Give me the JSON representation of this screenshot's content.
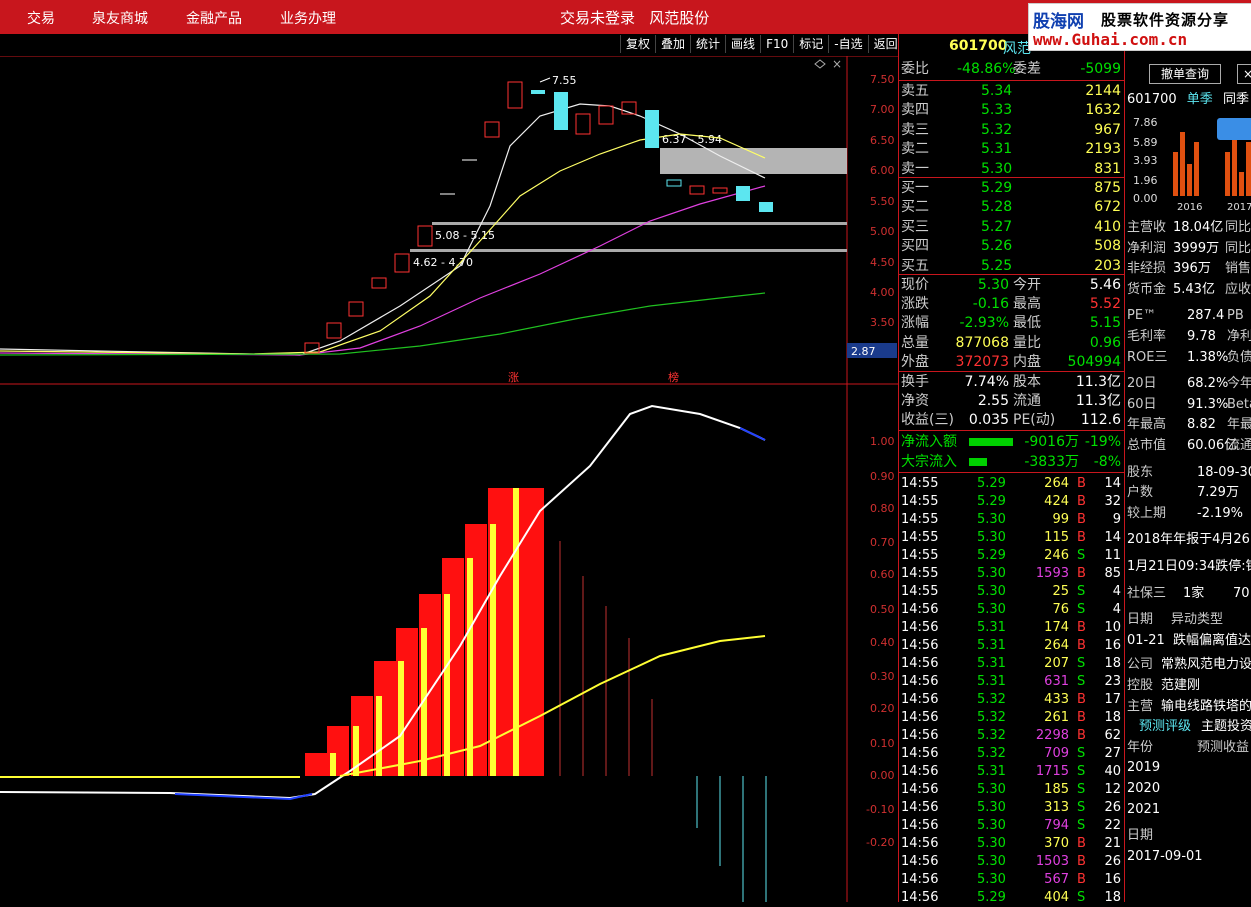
{
  "topbar": {
    "menu": [
      "交易",
      "泉友商城",
      "金融产品",
      "业务办理"
    ],
    "title": "交易未登录   风范股份",
    "ad_line1": "股海网",
    "ad_line1b": "股票软件资源分享",
    "ad_line2": "www.Guhai.com.cn"
  },
  "toolbar": [
    "复权",
    "叠加",
    "统计",
    "画线",
    "F10",
    "标记",
    "-自选",
    "返回"
  ],
  "price_axis": [
    "7.50",
    "7.00",
    "6.50",
    "6.00",
    "5.50",
    "5.00",
    "4.50",
    "4.00",
    "3.50"
  ],
  "price_tag": "2.87",
  "chart_annotations": [
    "7.55",
    "6.37 - 5.94",
    "5.08 - 5.15",
    "4.62 - 4.70",
    "涨",
    "榜"
  ],
  "ind_axis": [
    "1.00",
    "0.90",
    "0.80",
    "0.70",
    "0.60",
    "0.50",
    "0.40",
    "0.30",
    "0.20",
    "0.10",
    "0.00",
    "-0.10",
    "-0.20"
  ],
  "quote": {
    "code": "601700",
    "name": "风范",
    "weibi_label": "委比",
    "weibi": "-48.86%",
    "weicha_label": "委差",
    "weicha": "-5099",
    "asks": [
      {
        "label": "卖五",
        "price": "5.34",
        "vol": "2144"
      },
      {
        "label": "卖四",
        "price": "5.33",
        "vol": "1632"
      },
      {
        "label": "卖三",
        "price": "5.32",
        "vol": "967"
      },
      {
        "label": "卖二",
        "price": "5.31",
        "vol": "2193"
      },
      {
        "label": "卖一",
        "price": "5.30",
        "vol": "831"
      }
    ],
    "bids": [
      {
        "label": "买一",
        "price": "5.29",
        "vol": "875"
      },
      {
        "label": "买二",
        "price": "5.28",
        "vol": "672"
      },
      {
        "label": "买三",
        "price": "5.27",
        "vol": "410"
      },
      {
        "label": "买四",
        "price": "5.26",
        "vol": "508"
      },
      {
        "label": "买五",
        "price": "5.25",
        "vol": "203"
      }
    ],
    "stats": [
      {
        "l1": "现价",
        "v1": "5.30",
        "c1": "down",
        "l2": "今开",
        "v2": "5.46",
        "c2": "wht"
      },
      {
        "l1": "涨跌",
        "v1": "-0.16",
        "c1": "down",
        "l2": "最高",
        "v2": "5.52",
        "c2": "up"
      },
      {
        "l1": "涨幅",
        "v1": "-2.93%",
        "c1": "down",
        "l2": "最低",
        "v2": "5.15",
        "c2": "down"
      },
      {
        "l1": "总量",
        "v1": "877068",
        "c1": "yel",
        "l2": "量比",
        "v2": "0.96",
        "c2": "down"
      },
      {
        "l1": "外盘",
        "v1": "372073",
        "c1": "up",
        "l2": "内盘",
        "v2": "504994",
        "c2": "down"
      }
    ],
    "stats2": [
      {
        "l1": "换手",
        "v1": "7.74%",
        "l2": "股本",
        "v2": "11.3亿"
      },
      {
        "l1": "净资",
        "v1": "2.55",
        "l2": "流通",
        "v2": "11.3亿"
      },
      {
        "l1": "收益(三)",
        "v1": "0.035",
        "l2": "PE(动)",
        "v2": "112.6"
      }
    ],
    "flow": [
      {
        "label": "净流入额",
        "value": "-9016万",
        "pct": "-19%"
      },
      {
        "label": "大宗流入",
        "value": "-3833万",
        "pct": "-8%"
      }
    ],
    "ticks": [
      [
        "14:55",
        "5.29",
        "264",
        "B",
        "14"
      ],
      [
        "14:55",
        "5.29",
        "424",
        "B",
        "32"
      ],
      [
        "14:55",
        "5.30",
        "99",
        "B",
        "9"
      ],
      [
        "14:55",
        "5.30",
        "115",
        "B",
        "14"
      ],
      [
        "14:55",
        "5.29",
        "246",
        "S",
        "11"
      ],
      [
        "14:55",
        "5.30",
        "1593",
        "B",
        "85"
      ],
      [
        "14:55",
        "5.30",
        "25",
        "S",
        "4"
      ],
      [
        "14:56",
        "5.30",
        "76",
        "S",
        "4"
      ],
      [
        "14:56",
        "5.31",
        "174",
        "B",
        "10"
      ],
      [
        "14:56",
        "5.31",
        "264",
        "B",
        "16"
      ],
      [
        "14:56",
        "5.31",
        "207",
        "S",
        "18"
      ],
      [
        "14:56",
        "5.31",
        "631",
        "S",
        "23"
      ],
      [
        "14:56",
        "5.32",
        "433",
        "B",
        "17"
      ],
      [
        "14:56",
        "5.32",
        "261",
        "B",
        "18"
      ],
      [
        "14:56",
        "5.32",
        "2298",
        "B",
        "62"
      ],
      [
        "14:56",
        "5.32",
        "709",
        "S",
        "27"
      ],
      [
        "14:56",
        "5.31",
        "1715",
        "S",
        "40"
      ],
      [
        "14:56",
        "5.30",
        "185",
        "S",
        "12"
      ],
      [
        "14:56",
        "5.30",
        "313",
        "S",
        "26"
      ],
      [
        "14:56",
        "5.30",
        "794",
        "S",
        "22"
      ],
      [
        "14:56",
        "5.30",
        "370",
        "B",
        "21"
      ],
      [
        "14:56",
        "5.30",
        "1503",
        "B",
        "26"
      ],
      [
        "14:56",
        "5.30",
        "567",
        "B",
        "16"
      ],
      [
        "14:56",
        "5.29",
        "404",
        "S",
        "18"
      ]
    ]
  },
  "far": {
    "btn_cancel": "撤单查询",
    "code": "601700",
    "tab1": "单季",
    "tab2": "同季",
    "mini_axis": [
      "7.86",
      "5.89",
      "3.93",
      "1.96",
      "0.00"
    ],
    "mini_years": [
      "2016",
      "2017"
    ],
    "fin": [
      {
        "l": "主营收",
        "v": "18.04亿",
        "x": "同比"
      },
      {
        "l": "净利润",
        "v": "3999万",
        "x": "同比"
      },
      {
        "l": "非经损",
        "v": "396万",
        "x": "销售"
      },
      {
        "l": "货币金",
        "v": "5.43亿",
        "x": "应收"
      }
    ],
    "fin2": [
      {
        "l": "PE™",
        "v": "287.4",
        "x": "PB"
      },
      {
        "l": "毛利率",
        "v": "9.78",
        "x": "净利"
      },
      {
        "l": "ROE三",
        "v": "1.38%",
        "x": "负债"
      }
    ],
    "fin3": [
      {
        "l": "20日",
        "v": "68.2%",
        "x": "今年"
      },
      {
        "l": "60日",
        "v": "91.3%",
        "x": "Beta"
      },
      {
        "l": "年最高",
        "v": "8.82",
        "x": "年最"
      },
      {
        "l": "总市值",
        "v": "60.06亿",
        "x": "流通"
      }
    ],
    "holders": [
      {
        "l": "股东",
        "v": "18-09-30"
      },
      {
        "l": "户数",
        "v": "7.29万"
      },
      {
        "l": "较上期",
        "v": "-2.19%"
      }
    ],
    "notice1": "2018年年报于4月26",
    "notice2": "1月21日09:34跌停:银",
    "social_label": "社保三",
    "social_count": "1家",
    "social_val": "70",
    "event_head_l": "日期",
    "event_head_r": "异动类型",
    "event_date": "01-21",
    "event_text": "跌幅偏离值达",
    "company_label": "公司",
    "company": "常熟风范电力设",
    "ctrl_label": "控股",
    "ctrl": "范建刚",
    "main_label": "主营",
    "main": "输电线路铁塔的",
    "tab_rating": "预测评级",
    "tab_theme": "主题投资",
    "forecast_head_l": "年份",
    "forecast_head_r": "预测收益",
    "years": [
      "2019",
      "2020",
      "2021"
    ],
    "date_label": "日期",
    "date_val": "2017-09-01"
  }
}
